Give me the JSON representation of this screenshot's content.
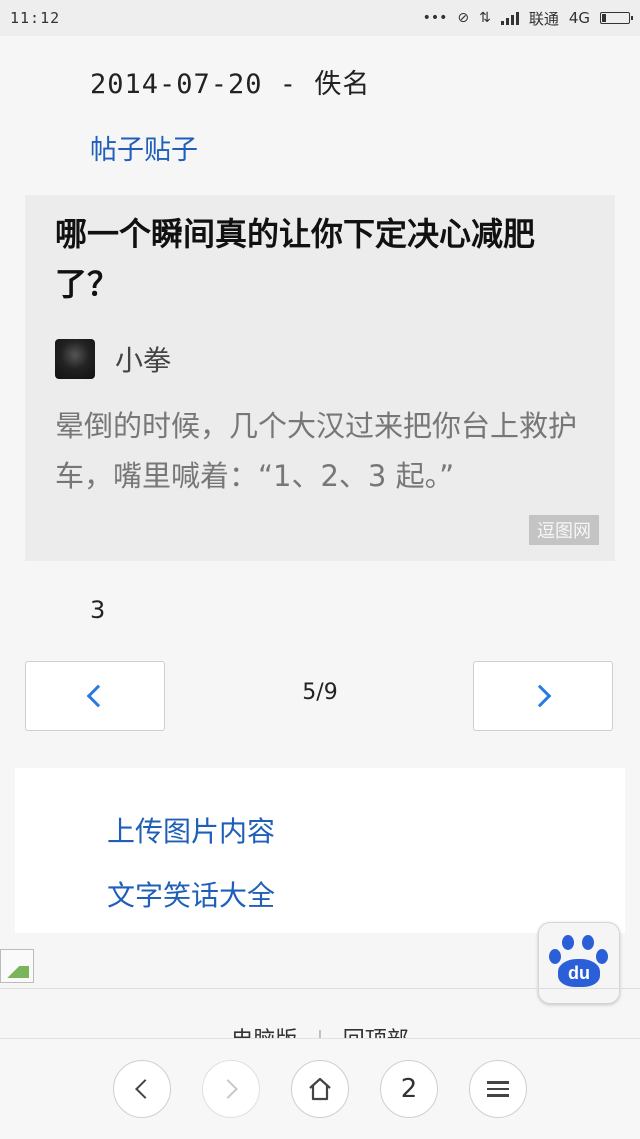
{
  "status_bar": {
    "time": "11:12",
    "carrier": "联通",
    "network": "4G"
  },
  "post": {
    "date_author": "2014-07-20 - 佚名",
    "category": "帖子贴子",
    "title": "哪一个瞬间真的让你下定决心减肥了？",
    "author": "小拳",
    "body": "晕倒的时候，几个大汉过来把你台上救护车，嘴里喊着：“1、2、3 起。”",
    "watermark": "逗图网",
    "page_number": "3"
  },
  "pager": {
    "indicator": "5/9"
  },
  "links": {
    "upload": "上传图片内容",
    "jokes": "文字笑话大全"
  },
  "baidu_badge": {
    "text": "du"
  },
  "footer": {
    "left": "电脑版",
    "right": "回顶部"
  },
  "browser_bar": {
    "tab_count": "2"
  },
  "colors": {
    "link_blue": "#1f5fb8",
    "chevron_blue": "#2a7be0",
    "baidu_blue": "#2a5fd8"
  },
  "icons": {
    "status": [
      "dots-icon",
      "mute-icon",
      "data-arrows-icon",
      "signal-icon",
      "battery-icon"
    ],
    "browser": [
      "back-icon",
      "forward-icon",
      "home-icon",
      "tabs-icon",
      "menu-icon"
    ]
  }
}
